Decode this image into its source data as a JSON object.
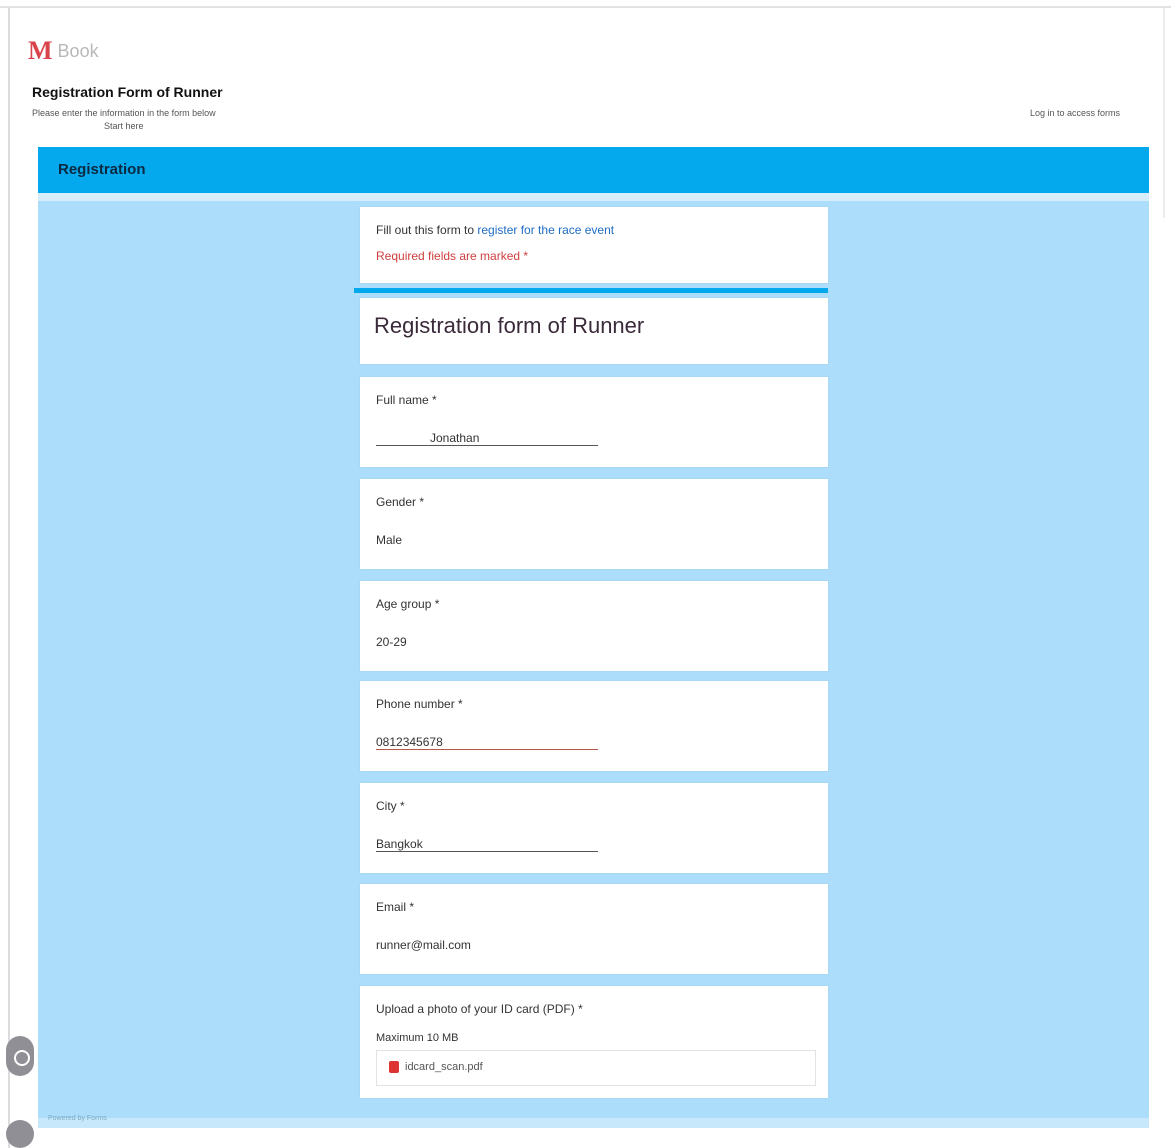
{
  "header": {
    "logo_text": "Book",
    "site_title": "Registration Form of Runner",
    "site_subtitle": "Please enter the information in the form below",
    "site_subtitle2": "Start here",
    "right_text": "Log in to access forms"
  },
  "nav": {
    "title": "Registration"
  },
  "notice": {
    "line1_prefix": "Fill out this form to",
    "line1_link": "register for the race event",
    "line2": "Required fields are marked *"
  },
  "form": {
    "title": "Registration form of Runner",
    "questions": [
      {
        "label": "Full name *",
        "value": "Jonathan"
      },
      {
        "label": "Gender *",
        "value": "Male"
      },
      {
        "label": "Age group *",
        "value": "20-29"
      },
      {
        "label": "Phone number *",
        "value": "0812345678"
      },
      {
        "label": "City *",
        "value": "Bangkok"
      },
      {
        "label": "Email *",
        "value": "runner@mail.com"
      }
    ],
    "upload": {
      "label": "Upload a photo of your ID card (PDF) *",
      "note": "Maximum 10 MB",
      "file": "idcard_scan.pdf"
    }
  },
  "footer": {
    "text": "Powered by Forms"
  },
  "colors": {
    "nav": "#04a8ec",
    "content_bg": "#acdefc",
    "brand_red": "#d9434b"
  },
  "icons": [
    "logo-mark",
    "file-pdf-icon",
    "chat-bubble-icon"
  ]
}
